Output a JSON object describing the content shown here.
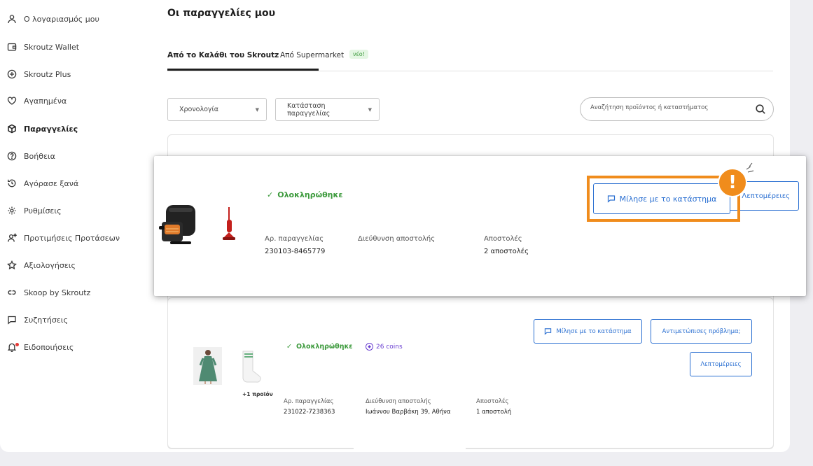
{
  "sidebar": {
    "items": [
      {
        "label": "Ο λογαριασμός μου",
        "icon": "user-icon"
      },
      {
        "label": "Skroutz Wallet",
        "icon": "wallet-icon"
      },
      {
        "label": "Skroutz Plus",
        "icon": "plus-circle-icon"
      },
      {
        "label": "Αγαπημένα",
        "icon": "heart-icon"
      },
      {
        "label": "Παραγγελίες",
        "icon": "package-icon",
        "active": true
      },
      {
        "label": "Βοήθεια",
        "icon": "help-icon"
      },
      {
        "label": "Αγόρασε ξανά",
        "icon": "rebuy-icon"
      },
      {
        "label": "Ρυθμίσεις",
        "icon": "gear-icon"
      },
      {
        "label": "Προτιμήσεις Προτάσεων",
        "icon": "preferences-icon"
      },
      {
        "label": "Αξιολογήσεις",
        "icon": "star-icon"
      },
      {
        "label": "Skoop by Skroutz",
        "icon": "skoop-icon"
      },
      {
        "label": "Συζητήσεις",
        "icon": "chat-icon"
      },
      {
        "label": "Ειδοποιήσεις",
        "icon": "bell-icon",
        "has_notification": true
      }
    ]
  },
  "header": {
    "title": "Οι παραγγελίες μου",
    "tabs": [
      {
        "label": "Από το Καλάθι του Skroutz",
        "active": true
      },
      {
        "label": "Από Supermarket",
        "badge": "νέο!"
      }
    ]
  },
  "filters": {
    "date_select": "Χρονολογία",
    "status_select": "Κατάσταση παραγγελίας",
    "search_placeholder": "Αναζήτηση προϊόντος ή καταστήματος"
  },
  "orders": [
    {
      "status": "Ολοκληρώθηκε",
      "order_no_label": "Αρ. παραγγελίας",
      "order_no": "230103-8465779",
      "address_label": "Διεύθυνση αποστολής",
      "shipments_label": "Αποστολές",
      "shipments": "2 αποστολές",
      "contact_button": "Μίλησε με το κατάστημα",
      "details_button": "Λεπτομέρειες",
      "products": [
        "air-fryer-image",
        "stick-vacuum-image"
      ]
    },
    {
      "status": "Ολοκληρώθηκε",
      "coins": "26 coins",
      "order_no_label": "Αρ. παραγγελίας",
      "order_no": "231022-7238363",
      "address_label": "Διεύθυνση αποστολής",
      "address": "Ιωάννου Βαρβάκη 39, Αθήνα",
      "shipments_label": "Αποστολές",
      "shipments": "1 αποστολή",
      "contact_button": "Μίλησε με το κατάστημα",
      "problem_button": "Αντιμετώπισες πρόβλημα;",
      "details_button": "Λεπτομέρειες",
      "extra_products": "+1 προϊόν",
      "products": [
        "green-dress-image",
        "white-socks-image"
      ]
    }
  ],
  "colors": {
    "accent_blue": "#2a6fd1",
    "success_green": "#3c9a3c",
    "highlight_orange": "#f08c1c",
    "coins_purple": "#6a3fd1"
  }
}
